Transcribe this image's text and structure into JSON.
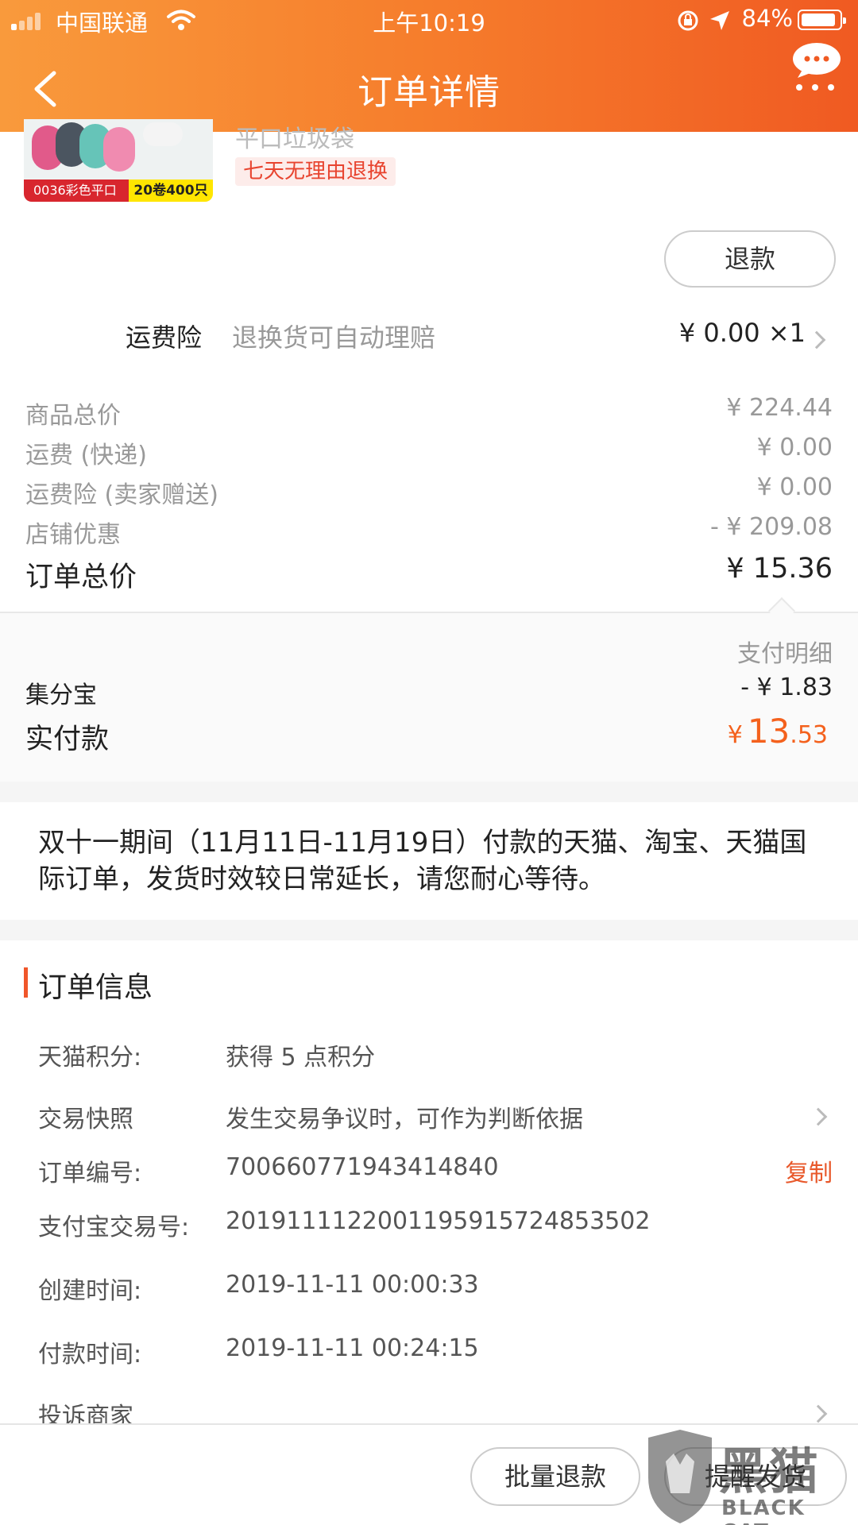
{
  "status_bar": {
    "carrier": "中国联通",
    "time": "上午10:19",
    "battery": "84%"
  },
  "nav": {
    "title": "订单详情"
  },
  "product": {
    "name_partial": "平口垃圾袋",
    "image_tag_red": "0036彩色平口",
    "image_tag_yellow": "20卷400只",
    "return_policy": "七天无理由退换",
    "refund_button": "退款"
  },
  "insurance": {
    "label": "运费险",
    "desc": "退换货可自动理赔",
    "value": "¥ 0.00 ×1"
  },
  "price_summary": {
    "rows": [
      {
        "label": "商品总价",
        "value": "¥ 224.44"
      },
      {
        "label": "运费 (快递)",
        "value": "¥ 0.00"
      },
      {
        "label": "运费险 (卖家赠送)",
        "value": "¥ 0.00"
      },
      {
        "label": "店铺优惠",
        "value": "- ¥ 209.08"
      }
    ],
    "total_label": "订单总价",
    "total_value": "¥ 15.36"
  },
  "payment": {
    "detail_link": "支付明细",
    "jifenbao_label": "集分宝",
    "jifenbao_value": "- ¥ 1.83",
    "paid_label": "实付款",
    "paid_currency": "¥",
    "paid_int": "13",
    "paid_dec": ".53"
  },
  "notice": {
    "text": "双十一期间（11月11日-11月19日）付款的天猫、淘宝、天猫国际订单，发货时效较日常延长，请您耐心等待。"
  },
  "order_info": {
    "heading": "订单信息",
    "points_label": "天猫积分:",
    "points_value": "获得 5 点积分",
    "snapshot_label": "交易快照",
    "snapshot_value": "发生交易争议时，可作为判断依据",
    "order_no_label": "订单编号:",
    "order_no_value": "700660771943414840",
    "copy_label": "复制",
    "alipay_label": "支付宝交易号:",
    "alipay_value": "2019111122001195915724853502",
    "created_label": "创建时间:",
    "created_value": "2019-11-11 00:00:33",
    "paid_time_label": "付款时间:",
    "paid_time_value": "2019-11-11 00:24:15",
    "complain_label": "投诉商家"
  },
  "bottom_bar": {
    "batch_refund": "批量退款",
    "remind_ship": "提醒发货"
  },
  "watermark": {
    "cn": "黑猫",
    "en": "BLACK CAT"
  },
  "colors": {
    "header_start": "#f99a3c",
    "header_end": "#f05a22",
    "accent": "#e8582a",
    "price_orange": "#f4611d"
  }
}
